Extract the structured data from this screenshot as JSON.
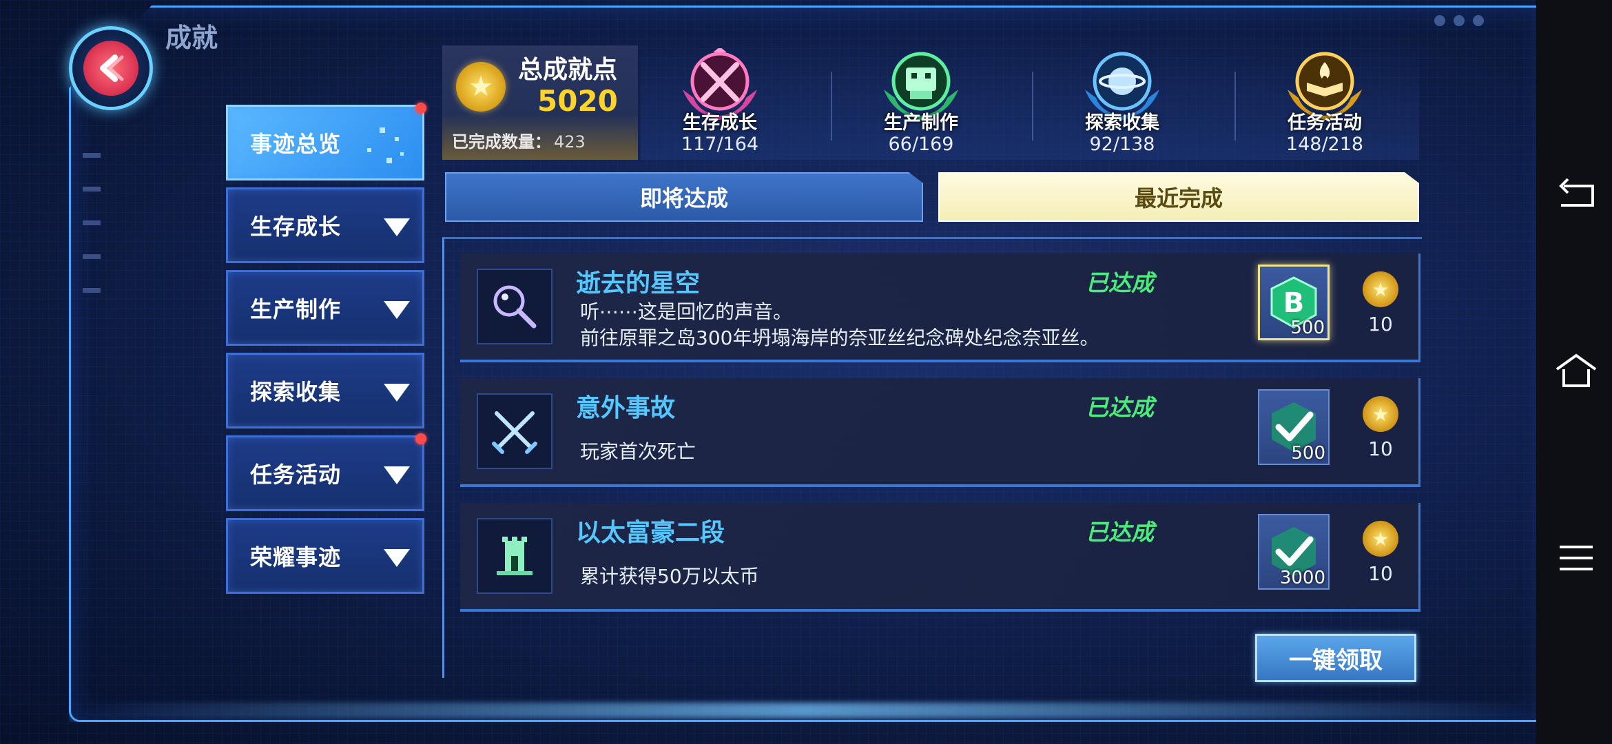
{
  "page": {
    "title": "成就"
  },
  "summary": {
    "title": "总成就点",
    "points": "5020",
    "completed_label": "已完成数量：",
    "completed_value": "423"
  },
  "categories": [
    {
      "name": "生存成长",
      "count": "117/164",
      "color": "#ff5fa8",
      "icon": "crossed-swords-icon"
    },
    {
      "name": "生产制作",
      "count": "66/169",
      "color": "#3fe38a",
      "icon": "robot-icon"
    },
    {
      "name": "探索收集",
      "count": "92/138",
      "color": "#4aa8ff",
      "icon": "planet-icon"
    },
    {
      "name": "任务活动",
      "count": "148/218",
      "color": "#ffbe2e",
      "icon": "book-flame-icon"
    }
  ],
  "nav": [
    {
      "label": "事迹总览",
      "active": true,
      "dot": true
    },
    {
      "label": "生存成长",
      "active": false,
      "dot": false
    },
    {
      "label": "生产制作",
      "active": false,
      "dot": false
    },
    {
      "label": "探索收集",
      "active": false,
      "dot": false
    },
    {
      "label": "任务活动",
      "active": false,
      "dot": true
    },
    {
      "label": "荣耀事迹",
      "active": false,
      "dot": false
    }
  ],
  "tabs": {
    "upcoming": "即将达成",
    "recent": "最近完成"
  },
  "rows": [
    {
      "name": "逝去的星空",
      "status": "已达成",
      "desc_line1": "听⋯⋯这是回忆的声音。",
      "desc_line2": "前往原罪之岛300年坍塌海岸的奈亚丝纪念碑处纪念奈亚丝。",
      "icon": "magnifier-icon",
      "reward_amount": "500",
      "points": "10"
    },
    {
      "name": "意外事故",
      "status": "已达成",
      "desc_line1": "玩家首次死亡",
      "icon": "crossed-swords-icon",
      "reward_amount": "500",
      "points": "10"
    },
    {
      "name": "以太富豪二段",
      "status": "已达成",
      "desc_line1": "累计获得50万以太币",
      "icon": "tower-icon",
      "reward_amount": "3000",
      "points": "10"
    }
  ],
  "claim_button": "一键领取",
  "colors": {
    "accent": "#55c8ff",
    "status": "#4cea7a",
    "gold": "#ffd42a"
  }
}
